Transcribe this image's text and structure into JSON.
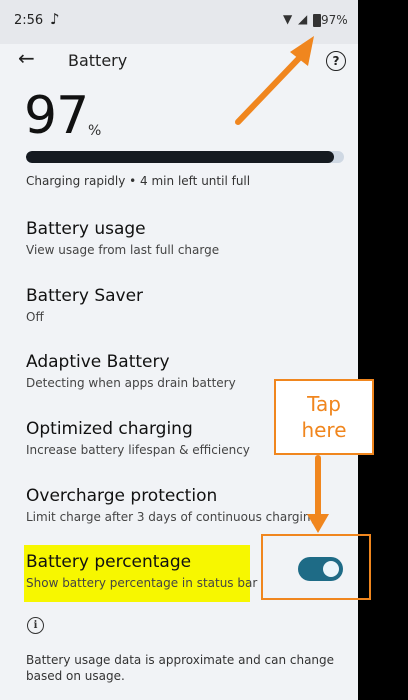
{
  "status_bar": {
    "time": "2:56",
    "notification_icon": "tiktok-icon",
    "battery_text": "97%"
  },
  "app_bar": {
    "title": "Battery",
    "back_icon": "arrow-left-icon",
    "help_icon": "help-circle-icon"
  },
  "battery_level": {
    "value": "97",
    "unit": "%",
    "fill_fraction": 0.97,
    "status": "Charging rapidly • 4 min left until full"
  },
  "items": [
    {
      "title": "Battery usage",
      "subtitle": "View usage from last full charge"
    },
    {
      "title": "Battery Saver",
      "subtitle": "Off"
    },
    {
      "title": "Adaptive Battery",
      "subtitle": "Detecting when apps drain battery"
    },
    {
      "title": "Optimized charging",
      "subtitle": "Increase battery lifespan & efficiency"
    },
    {
      "title": "Overcharge protection",
      "subtitle": "Limit charge after 3 days of continuous charging"
    },
    {
      "title": "Battery percentage",
      "subtitle": "Show battery percentage in status bar",
      "toggle_on": true
    }
  ],
  "footer": {
    "info_icon": "info-icon",
    "note": "Battery usage data is approximate and can change based on usage."
  },
  "annotation": {
    "callout_text_line1": "Tap",
    "callout_text_line2": "here",
    "accent_color": "#f0861e",
    "highlight_color": "#f7f700",
    "toggle_color": "#1e6b86"
  }
}
